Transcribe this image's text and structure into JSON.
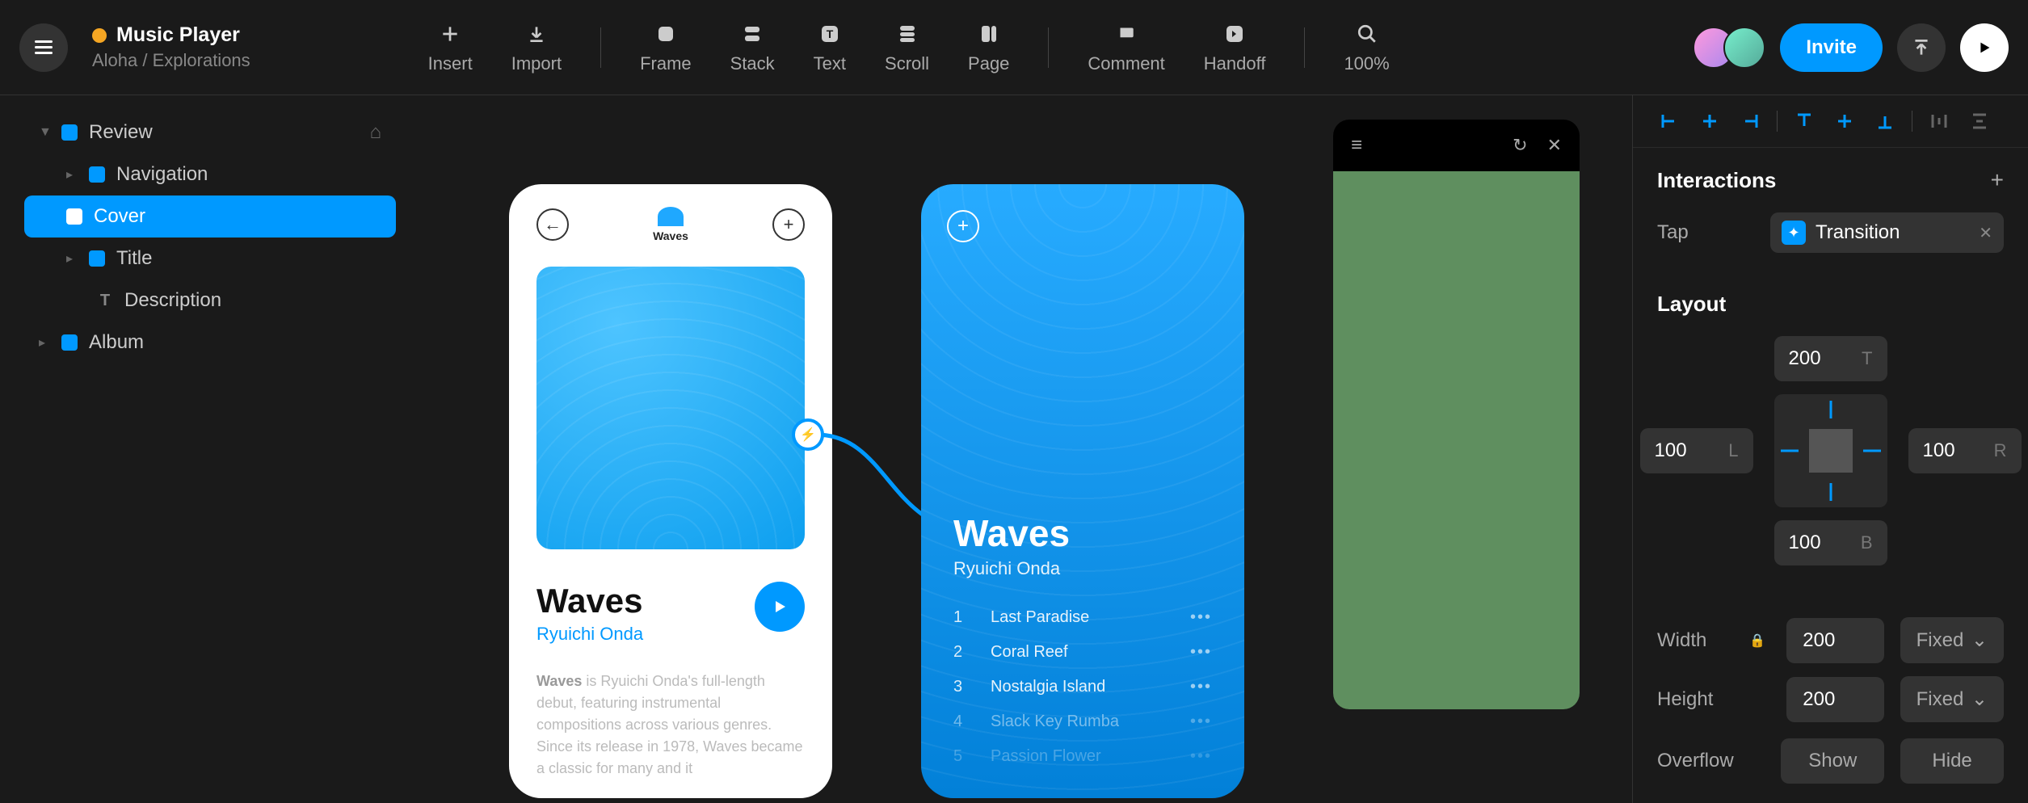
{
  "header": {
    "project_title": "Music Player",
    "project_path": "Aloha / Explorations",
    "tools": [
      "Insert",
      "Import",
      "Frame",
      "Stack",
      "Text",
      "Scroll",
      "Page",
      "Comment",
      "Handoff"
    ],
    "zoom": "100%",
    "invite_label": "Invite"
  },
  "sidebar": {
    "items": [
      {
        "label": "Review",
        "level": 0,
        "expanded": true,
        "icon": "frame"
      },
      {
        "label": "Navigation",
        "level": 1,
        "icon": "frame"
      },
      {
        "label": "Cover",
        "level": 1,
        "icon": "frame",
        "selected": true
      },
      {
        "label": "Title",
        "level": 1,
        "icon": "frame"
      },
      {
        "label": "Description",
        "level": 1,
        "icon": "text"
      },
      {
        "label": "Album",
        "level": 0,
        "icon": "frame"
      }
    ]
  },
  "canvas": {
    "phone1": {
      "brand": "Waves",
      "album_title": "Waves",
      "artist": "Ryuichi Onda",
      "description_bold": "Waves",
      "description_rest": " is Ryuichi Onda's full-length debut, featuring instrumental compositions across various genres. Since its release in 1978, Waves became a classic for many and it"
    },
    "phone2": {
      "title": "Waves",
      "artist": "Ryuichi Onda",
      "tracks": [
        {
          "n": "1",
          "name": "Last Paradise"
        },
        {
          "n": "2",
          "name": "Coral Reef"
        },
        {
          "n": "3",
          "name": "Nostalgia Island"
        },
        {
          "n": "4",
          "name": "Slack Key Rumba"
        },
        {
          "n": "5",
          "name": "Passion Flower"
        }
      ]
    }
  },
  "props": {
    "interactions": {
      "title": "Interactions",
      "event": "Tap",
      "action": "Transition"
    },
    "layout": {
      "title": "Layout",
      "top": "200",
      "left": "100",
      "right": "100",
      "bottom": "100",
      "width_label": "Width",
      "width": "200",
      "width_mode": "Fixed",
      "height_label": "Height",
      "height": "200",
      "height_mode": "Fixed",
      "overflow_label": "Overflow",
      "overflow_show": "Show",
      "overflow_hide": "Hide"
    }
  }
}
